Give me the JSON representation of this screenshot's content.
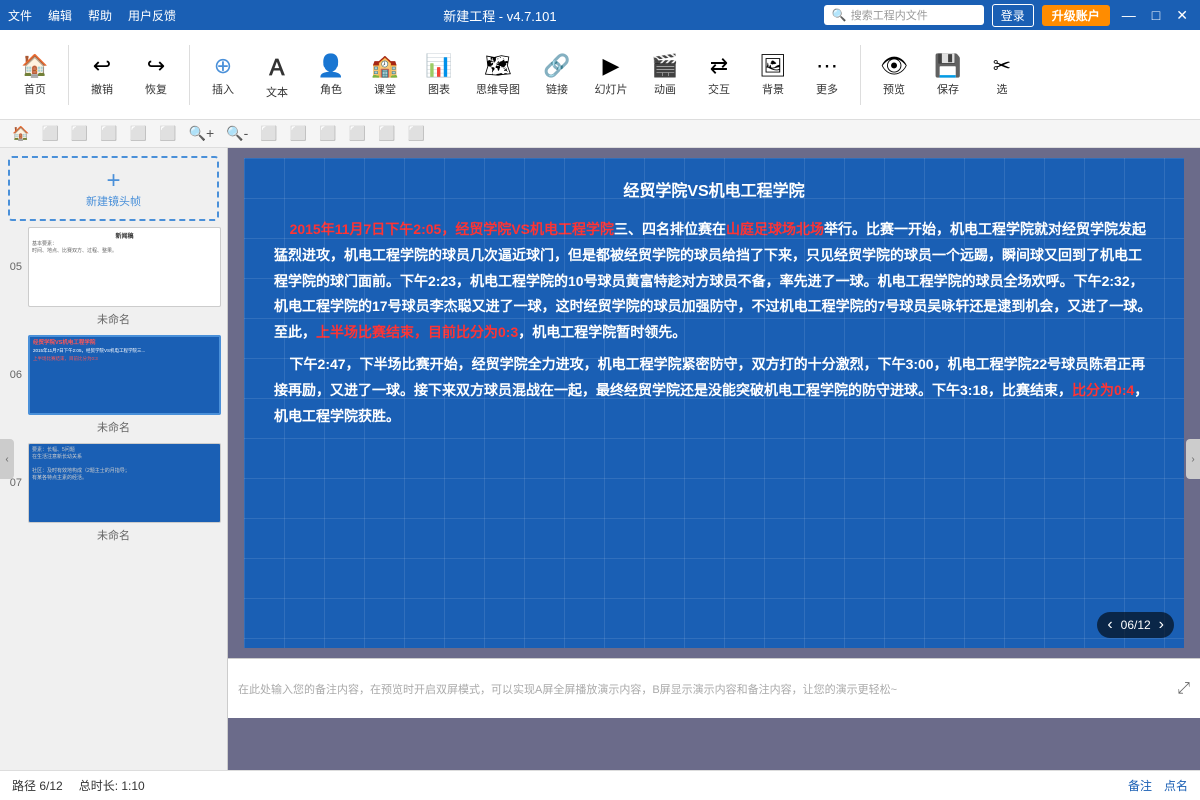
{
  "titleBar": {
    "menus": [
      "文件",
      "编辑",
      "帮助",
      "用户反馈"
    ],
    "title": "新建工程 - v4.7.101",
    "searchPlaceholder": "搜索工程内文件",
    "loginLabel": "登录",
    "upgradeLabel": "升级账户",
    "winBtns": [
      "—",
      "□",
      "✕"
    ]
  },
  "toolbar": {
    "items": [
      {
        "icon": "🏠",
        "label": "首页"
      },
      {
        "icon": "↩",
        "label": "撤销"
      },
      {
        "icon": "↪",
        "label": "恢复"
      },
      {
        "icon": "+",
        "label": "插入"
      },
      {
        "icon": "T",
        "label": "文本"
      },
      {
        "icon": "👤",
        "label": "角色"
      },
      {
        "icon": "⬛",
        "label": "课堂"
      },
      {
        "icon": "📊",
        "label": "图表"
      },
      {
        "icon": "🗺",
        "label": "思维导图"
      },
      {
        "icon": "🔗",
        "label": "链接"
      },
      {
        "icon": "▶",
        "label": "幻灯片"
      },
      {
        "icon": "🎬",
        "label": "动画"
      },
      {
        "icon": "⇄",
        "label": "交互"
      },
      {
        "icon": "🖼",
        "label": "背景"
      },
      {
        "icon": "⋯",
        "label": "更多"
      },
      {
        "icon": "👁",
        "label": "预览"
      },
      {
        "icon": "💾",
        "label": "保存"
      },
      {
        "icon": "✂",
        "label": "选"
      }
    ]
  },
  "subToolbar": {
    "items": [
      "🏠",
      "⬜",
      "⬜",
      "⬜",
      "⬜",
      "⬜",
      "⬜",
      "🔍+",
      "🔍-",
      "⬜",
      "⬜",
      "⬜",
      "⬜",
      "⬜",
      "⬜",
      "⬜"
    ]
  },
  "slides": [
    {
      "num": "",
      "label": "新建镜头帧",
      "isNew": true
    },
    {
      "num": "05",
      "label": "未命名",
      "type": "news"
    },
    {
      "num": "06",
      "label": "未命名",
      "type": "active",
      "active": true
    },
    {
      "num": "07",
      "label": "未命名",
      "type": "notes"
    }
  ],
  "canvas": {
    "title": "经贸学院VS机电工程学院",
    "content": "2015年11月7日下午2:05，经贸学院VS机电工程学院三、四名排位赛在山庭足球场北场举行。比赛一开始，机电工程学院就对经贸学院发起猛烈进攻，机电工程学院的球员几次逼近球门，但是都被经贸学院的球员给挡了下来，只见经贸学院的球员一个远踢，瞬间球又回到了机电工程学院的球门面前。下午2:23，机电工程学院的10号球员黄富特趁对方球员不备，率先进了一球。机电工程学院的球员全场欢呼。下午2:32，机电工程学院的17号球员李杰聪又进了一球，这时经贸学院的球员加强防守，不过机电工程学院的7号球员吴咏轩还是逮到机会，又进了一球。至此，上半场比赛结束，目前比分为0:3，机电工程学院暂时领先。\n    下午2:47，下半场比赛开始，经贸学院全力进攻，机电工程学院紧密防守，双方打的十分激烈，下午3:00，机电工程学院22号球员陈君正再接再励，又进了一球。接下来双方球员混战在一起，最终经贸学院还是没能突破机电工程学院的防守进球。下午3:18，比赛结束，比分为0:4，机电工程学院获胜。",
    "redPhrases": [
      "2015年11月7日下午2:05，经贸学院VS机电工程学院",
      "山庭足球场北场",
      "上半场比赛结束，目前比分为0:3",
      "比分为0:4"
    ],
    "counter": "06/12"
  },
  "notes": {
    "placeholder": "在此处输入您的备注内容，在预览时开启双屏模式，可以实现A屏全屏播放演示内容，B屏显示演示内容和备注内容，让您的演示更轻松~"
  },
  "statusBar": {
    "path": "路径 6/12",
    "duration": "总时长: 1:10",
    "actions": [
      "备注",
      "点名"
    ]
  }
}
